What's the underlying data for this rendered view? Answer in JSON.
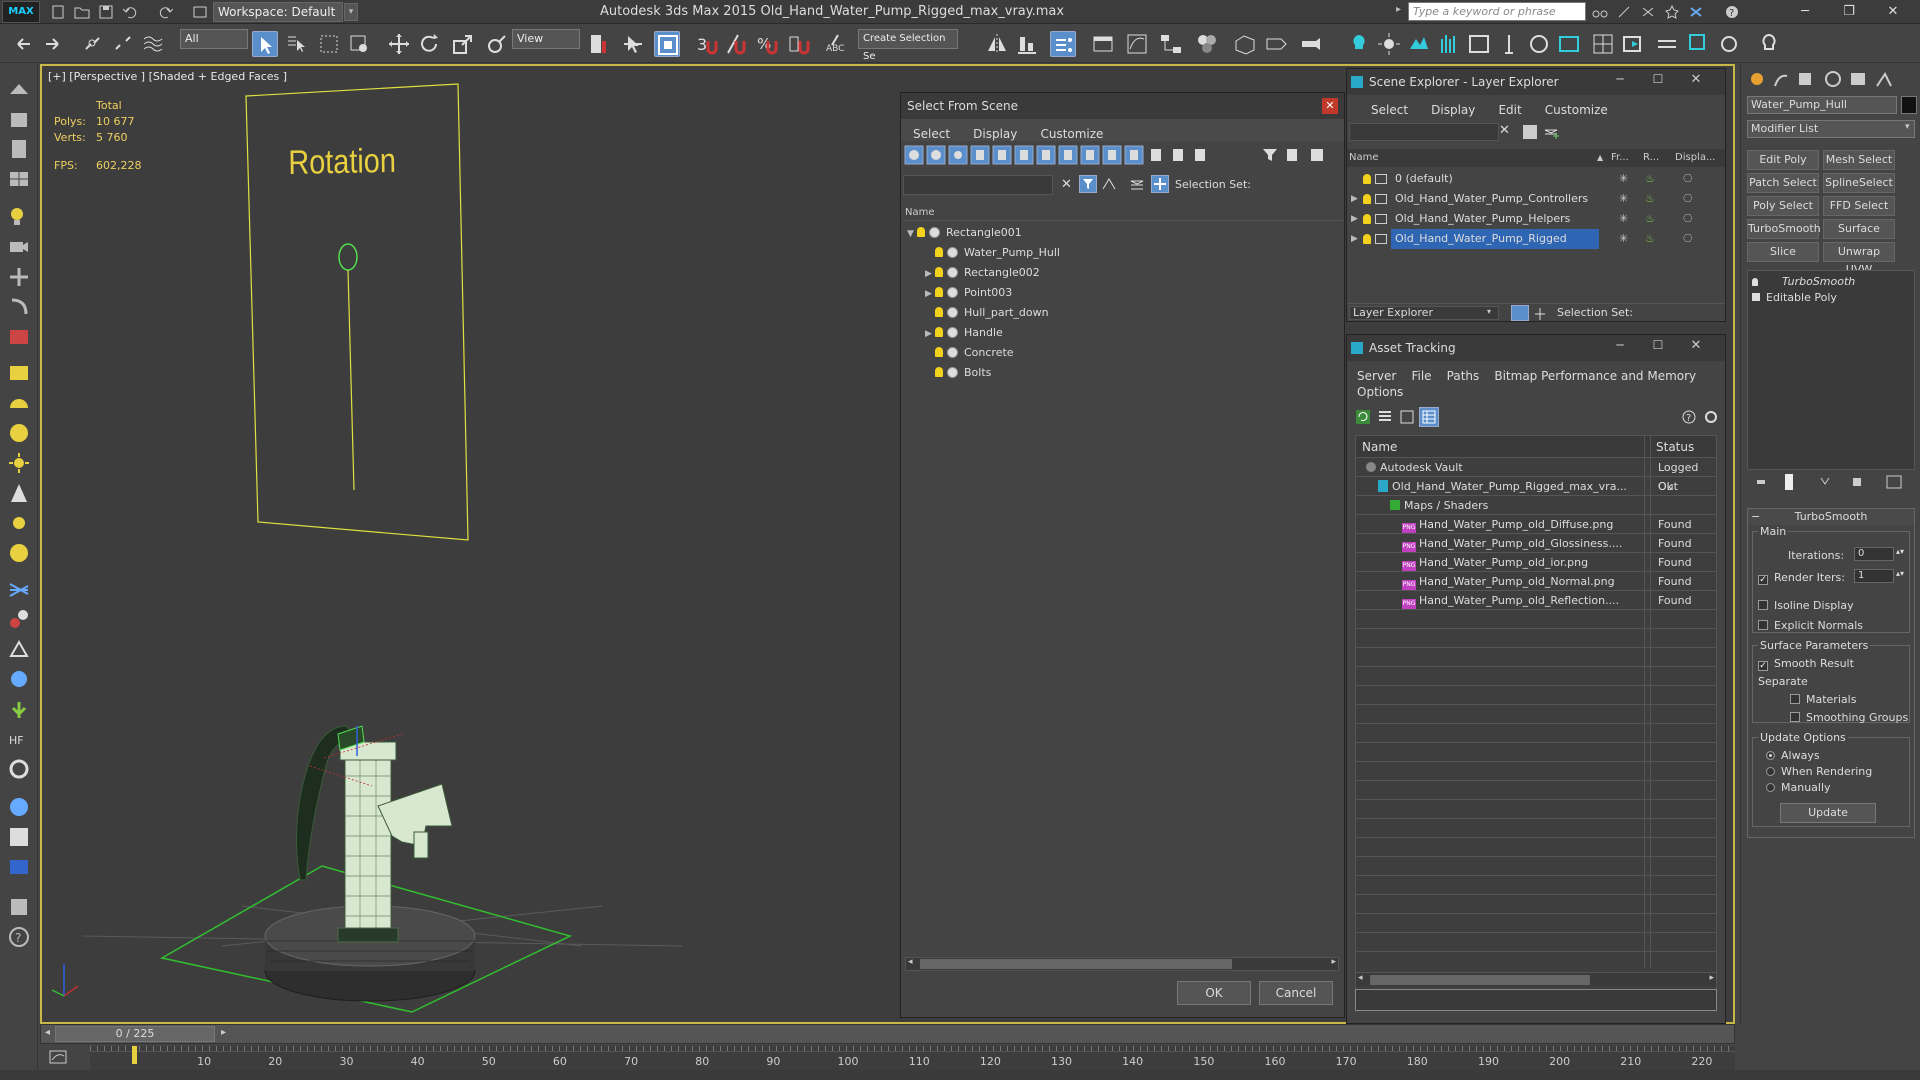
{
  "app": {
    "logo": "MAX",
    "title": "Autodesk 3ds Max  2015     Old_Hand_Water_Pump_Rigged_max_vray.max",
    "workspace": "Workspace: Default",
    "search_placeholder": "Type a keyword or phrase"
  },
  "toolbar": {
    "selection_filter": "All",
    "ref_coord": "View",
    "selection_set": "Create Selection Se"
  },
  "viewport": {
    "label": "[+] [Perspective ] [Shaded + Edged Faces ]",
    "stats": {
      "total_label": "Total",
      "polys_label": "Polys:",
      "polys": "10 677",
      "verts_label": "Verts:",
      "verts": "5 760",
      "fps_label": "FPS:",
      "fps": "602,228"
    },
    "rotation_text": "Rotation"
  },
  "select_from_scene": {
    "title": "Select From Scene",
    "menu": [
      "Select",
      "Display",
      "Customize"
    ],
    "selection_set_label": "Selection Set:",
    "column_name": "Name",
    "items": [
      {
        "name": "Rectangle001",
        "expand": "open",
        "indent": 0
      },
      {
        "name": "Water_Pump_Hull",
        "expand": "",
        "indent": 1
      },
      {
        "name": "Rectangle002",
        "expand": "closed",
        "indent": 1
      },
      {
        "name": "Point003",
        "expand": "closed",
        "indent": 1
      },
      {
        "name": "Hull_part_down",
        "expand": "",
        "indent": 1
      },
      {
        "name": "Handle",
        "expand": "closed",
        "indent": 1
      },
      {
        "name": "Concrete",
        "expand": "",
        "indent": 1
      },
      {
        "name": "Bolts",
        "expand": "",
        "indent": 1
      }
    ],
    "ok_label": "OK",
    "cancel_label": "Cancel"
  },
  "scene_explorer": {
    "title": "Scene Explorer - Layer Explorer",
    "menu": [
      "Select",
      "Display",
      "Edit",
      "Customize"
    ],
    "columns": [
      "Name",
      "Fr...",
      "R...",
      "Displa..."
    ],
    "layers": [
      {
        "name": "0 (default)",
        "selected": false
      },
      {
        "name": "Old_Hand_Water_Pump_Controllers",
        "selected": false
      },
      {
        "name": "Old_Hand_Water_Pump_Helpers",
        "selected": false
      },
      {
        "name": "Old_Hand_Water_Pump_Rigged",
        "selected": true
      }
    ],
    "explorer_select": "Layer Explorer",
    "selection_set_label": "Selection Set:"
  },
  "asset_tracking": {
    "title": "Asset Tracking",
    "menu": [
      "Server",
      "File",
      "Paths",
      "Bitmap Performance and Memory"
    ],
    "menu2": "Options",
    "columns": [
      "Name",
      "Status"
    ],
    "rows": [
      {
        "name": "Autodesk Vault",
        "status": "Logged Out",
        "indent": 1,
        "kind": "vault"
      },
      {
        "name": "Old_Hand_Water_Pump_Rigged_max_vra...",
        "status": "Ok",
        "indent": 2,
        "kind": "max"
      },
      {
        "name": "Maps / Shaders",
        "status": "",
        "indent": 3,
        "kind": "folder"
      },
      {
        "name": "Hand_Water_Pump_old_Diffuse.png",
        "status": "Found",
        "indent": 4,
        "kind": "png"
      },
      {
        "name": "Hand_Water_Pump_old_Glossiness....",
        "status": "Found",
        "indent": 4,
        "kind": "png"
      },
      {
        "name": "Hand_Water_Pump_old_ior.png",
        "status": "Found",
        "indent": 4,
        "kind": "png"
      },
      {
        "name": "Hand_Water_Pump_old_Normal.png",
        "status": "Found",
        "indent": 4,
        "kind": "png"
      },
      {
        "name": "Hand_Water_Pump_old_Reflection....",
        "status": "Found",
        "indent": 4,
        "kind": "png"
      }
    ]
  },
  "command_panel": {
    "object_name": "Water_Pump_Hull",
    "modifier_list": "Modifier List",
    "buttons": [
      "Edit Poly",
      "Mesh Select",
      "Patch Select",
      "SplineSelect",
      "Poly Select",
      "FFD Select",
      "TurboSmooth",
      "Surface Select",
      "Slice",
      "Unwrap UVW"
    ],
    "stack": [
      "TurboSmooth",
      "Editable Poly"
    ],
    "rollout_title": "TurboSmooth",
    "main_label": "Main",
    "iterations_label": "Iterations:",
    "iterations": "0",
    "render_iters_label": "Render Iters:",
    "render_iters": "1",
    "isoline_label": "Isoline Display",
    "explicit_normals_label": "Explicit Normals",
    "surface_params_label": "Surface Parameters",
    "smooth_result_label": "Smooth Result",
    "separate_label": "Separate",
    "materials_label": "Materials",
    "smoothing_groups_label": "Smoothing Groups",
    "update_options_label": "Update Options",
    "always_label": "Always",
    "when_rendering_label": "When Rendering",
    "manually_label": "Manually",
    "update_button": "Update"
  },
  "timeline": {
    "frame": "0 / 225",
    "ticks": [
      "10",
      "20",
      "30",
      "40",
      "50",
      "60",
      "70",
      "80",
      "90",
      "100",
      "110",
      "120",
      "130",
      "140",
      "150",
      "160",
      "170",
      "180",
      "190",
      "200",
      "210",
      "220"
    ]
  }
}
